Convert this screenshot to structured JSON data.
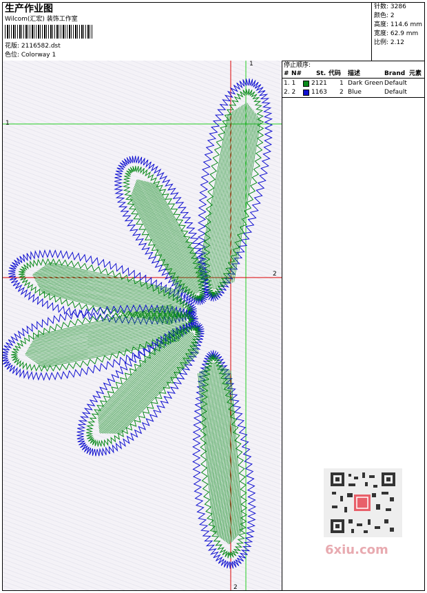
{
  "header": {
    "title": "生产作业图",
    "company": "Wilcom(汇宏) 装饰工作室",
    "design_label": "花版: 2116582.dst",
    "colorway_label": "色位: Colorway 1"
  },
  "stats": {
    "stitches": "针数: 3286",
    "colors": "颜色: 2",
    "height": "高度: 114.6 mm",
    "width": "宽度: 62.9 mm",
    "scale": "比例: 2.12"
  },
  "stop_sequence": {
    "title": "停止顺序:",
    "columns": [
      "#",
      "N#",
      "St.",
      "代码",
      "描述",
      "Brand",
      "元素"
    ],
    "rows": [
      {
        "index": "1. 1",
        "swatch_color": "#0a8a1a",
        "stitches": "2121",
        "code": "1",
        "description": "Dark Green",
        "brand": "Default"
      },
      {
        "index": "2. 2",
        "swatch_color": "#1010d0",
        "stitches": "1163",
        "code": "2",
        "description": "Blue",
        "brand": "Default"
      }
    ]
  },
  "guides": {
    "green_label_top": "1",
    "green_label_left": "1",
    "red_label_right": "2",
    "red_label_bottom": "2"
  },
  "colors": {
    "green_thread": "#0a8a1a",
    "blue_thread": "#1010d0",
    "green_guide": "#22cc22",
    "red_guide": "#dd0000"
  },
  "watermark": {
    "text": "6xiu.com"
  }
}
